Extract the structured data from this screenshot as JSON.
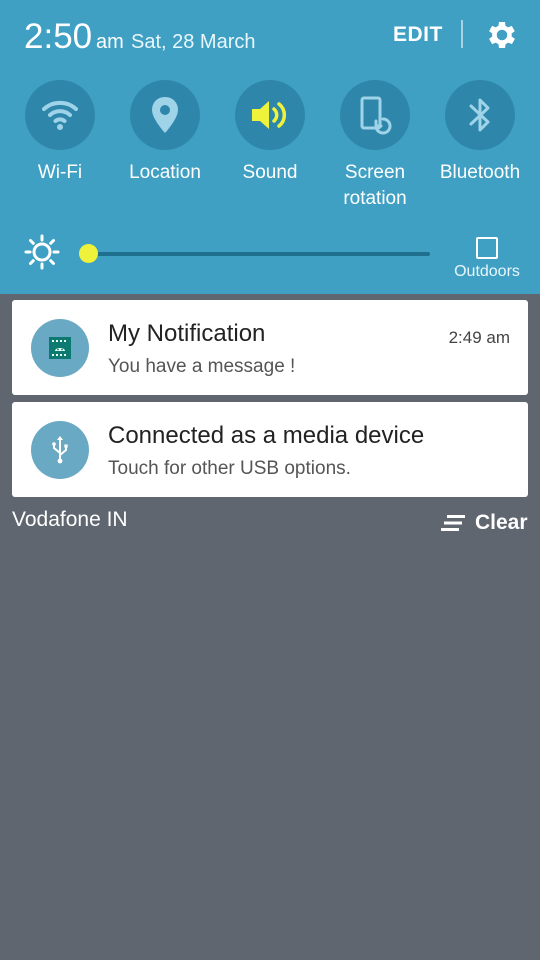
{
  "status": {
    "time": "2:50",
    "ampm": "am",
    "date": "Sat, 28 March"
  },
  "header": {
    "edit_label": "EDIT",
    "settings_icon": "gear-icon"
  },
  "quick_toggles": [
    {
      "label": "Wi-Fi",
      "icon": "wifi-icon",
      "active": false
    },
    {
      "label": "Location",
      "icon": "location-icon",
      "active": false
    },
    {
      "label": "Sound",
      "icon": "sound-icon",
      "active": true
    },
    {
      "label": "Screen\nrotation",
      "icon": "screen-rotation-icon",
      "active": false
    },
    {
      "label": "Bluetooth",
      "icon": "bluetooth-icon",
      "active": false
    }
  ],
  "brightness": {
    "level": 0.0,
    "outdoors_label": "Outdoors",
    "thumb_color": "#eef23b"
  },
  "notifications": [
    {
      "title": "My Notification",
      "text": "You have a message !",
      "time": "2:49 am",
      "icon": "android-icon"
    },
    {
      "title": "Connected as a media device",
      "text": "Touch for other USB options.",
      "time": "",
      "icon": "usb-icon"
    }
  ],
  "footer": {
    "carrier": "Vodafone IN",
    "clear_label": "Clear"
  },
  "colors": {
    "panel": "#3fa0c4",
    "toggle_bg": "#2e87ab",
    "active": "#eef23b",
    "background": "#5f6670"
  }
}
